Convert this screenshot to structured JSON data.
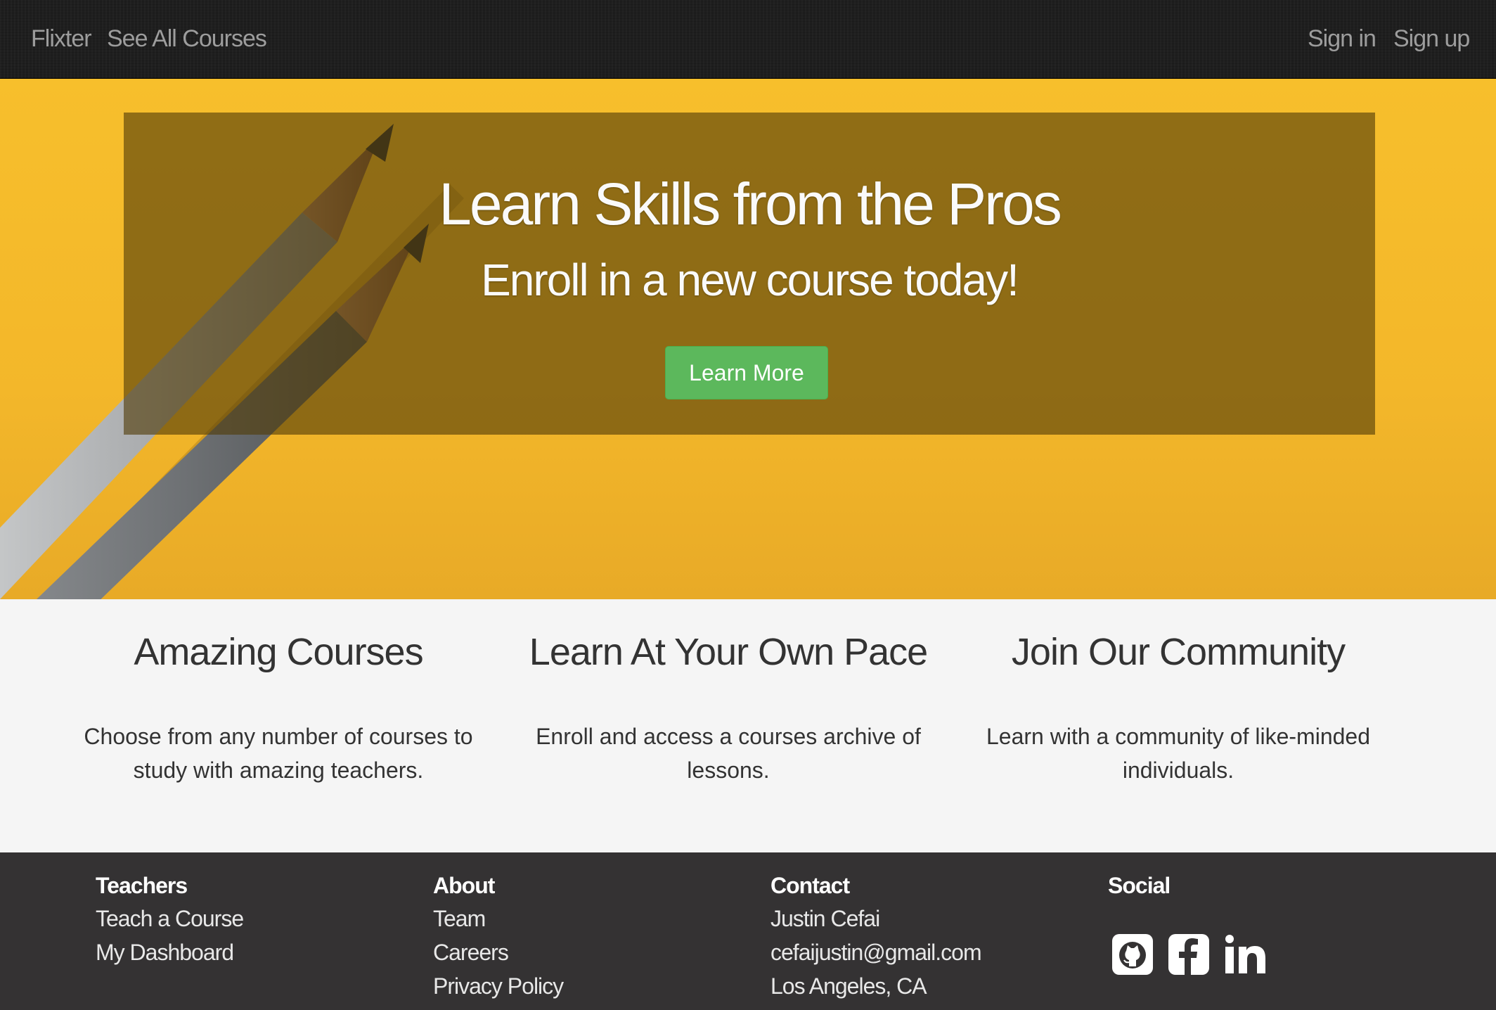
{
  "navbar": {
    "brand": "Flixter",
    "see_all_courses": "See All Courses",
    "sign_in": "Sign in",
    "sign_up": "Sign up"
  },
  "hero": {
    "title": "Learn Skills from the Pros",
    "subtitle": "Enroll in a new course today!",
    "button_label": "Learn More"
  },
  "features": [
    {
      "title": "Amazing Courses",
      "text": "Choose from any number of courses to study with amazing teachers."
    },
    {
      "title": "Learn At Your Own Pace",
      "text": "Enroll and access a courses archive of lessons."
    },
    {
      "title": "Join Our Community",
      "text": "Learn with a community of like-minded individuals."
    }
  ],
  "footer": {
    "teachers": {
      "heading": "Teachers",
      "links": [
        "Teach a Course",
        "My Dashboard"
      ]
    },
    "about": {
      "heading": "About",
      "links": [
        "Team",
        "Careers",
        "Privacy Policy"
      ]
    },
    "contact": {
      "heading": "Contact",
      "lines": [
        "Justin Cefai",
        "cefaijustin@gmail.com",
        "Los Angeles, CA"
      ]
    },
    "social": {
      "heading": "Social",
      "icons": [
        "github-icon",
        "facebook-icon",
        "linkedin-icon"
      ]
    }
  },
  "colors": {
    "hero_yellow": "#f5bb2b",
    "button_green": "#5cb85c",
    "footer_bg": "#343233",
    "navbar_bg": "#1e1e1e"
  }
}
